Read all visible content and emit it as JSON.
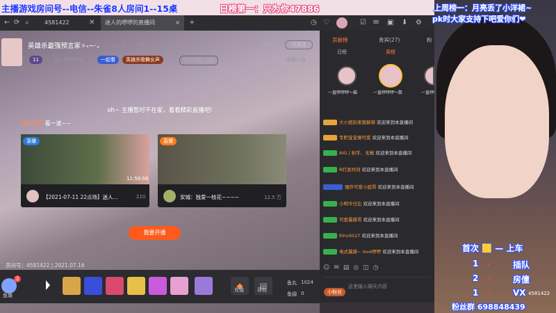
{
  "overlay": {
    "top_left": "主播游戏房间号--电信--朱雀8人房间1--15桌",
    "rank_banner": "日榜第一：只为你47886",
    "right_top_line1": "上周榜一：月亮丢了小洋裙~",
    "right_top_line2": "pk时大家支持下吧爱你们❤",
    "rule1": "首次 🟨 — 上车",
    "rule2_num": "1",
    "rule2_text": "插队",
    "rule3_num": "2",
    "rule3_text": "房僮",
    "rule4_num": "1",
    "rule4_text": "VX",
    "fan_group": "粉丝群 698848439",
    "cam_room": "4581422"
  },
  "browser": {
    "search_value": "4581422",
    "tab_title": "迷人的啰啰的直播间",
    "close": "×",
    "add": "+"
  },
  "room": {
    "title": "英雄杀最强预言家✧˖~‧₊",
    "hot": "6.7 万",
    "time": "2021-07-16 06:35",
    "category": "卡司互娱",
    "rank_num": "38852",
    "follow": "已关注",
    "name_tag": "迷人的啰啰的",
    "group_tag": "一起看",
    "hero_tag": "英雄杀歌舞女声",
    "weekly": "本周贡献 308",
    "notice": "直播公告",
    "level": "11"
  },
  "main": {
    "offline_text": "oh~ 主播暂时不在家，看看精彩直播吧!",
    "section_label": "精彩视频",
    "section_sub": "看一波~~",
    "card1_badge": "录播",
    "card1_title": "【2021-07-11 22点场】迷人...",
    "card1_count": "210",
    "card1_duration": "11:59:56",
    "card2_badge": "直播",
    "card2_title": "安城：独爱一枝花~~~~",
    "card2_count": "12.5 万",
    "watch_btn": "我要开播",
    "room_info": "房间号：4581422 | 2021.07.16"
  },
  "giftbar": {
    "fish": "鱼塘",
    "fish_count": "2",
    "recharge": "充值",
    "bag": "背包",
    "fish_ball": "鱼丸",
    "fish_ball_val": "1024",
    "fish_wing": "鱼翅",
    "fish_wing_val": "0"
  },
  "chat": {
    "tab_contrib": "贡献榜",
    "tab_noble": "贵宾(27)",
    "tab_fans": "粉",
    "day": "日榜",
    "week": "周榜",
    "top1": "一直啰啰啰～猫",
    "top2": "一直啰啰啰～数",
    "top3": "一直啰啰",
    "rows": [
      {
        "name": "大小姐别来我解释",
        "msg": "欢迎来到本直播间"
      },
      {
        "name": "专职宝宝做可爱",
        "msg": "欢迎来到本直播间"
      },
      {
        "name": "AIG丿射手、无鬓",
        "msg": "欢迎来到本直播间"
      },
      {
        "name": "R打发时间",
        "msg": "欢迎来到本直播间"
      },
      {
        "name": "骚炸可爱小屁哥",
        "msg": "欢迎来到本直播间"
      },
      {
        "name": "小明今日比",
        "msg": "欢迎来到本直播间"
      },
      {
        "name": "可爱暴躁哥",
        "msg": "欢迎来到本直播间"
      },
      {
        "name": "lhhv9527",
        "msg": "欢迎来到本直播间"
      },
      {
        "name": "电式暴躁~ love啰啰",
        "msg": "欢迎来到本直播间"
      }
    ],
    "input_placeholder": "这里输入聊天内容",
    "send": "发送",
    "mini_tag": "小粉丝"
  }
}
